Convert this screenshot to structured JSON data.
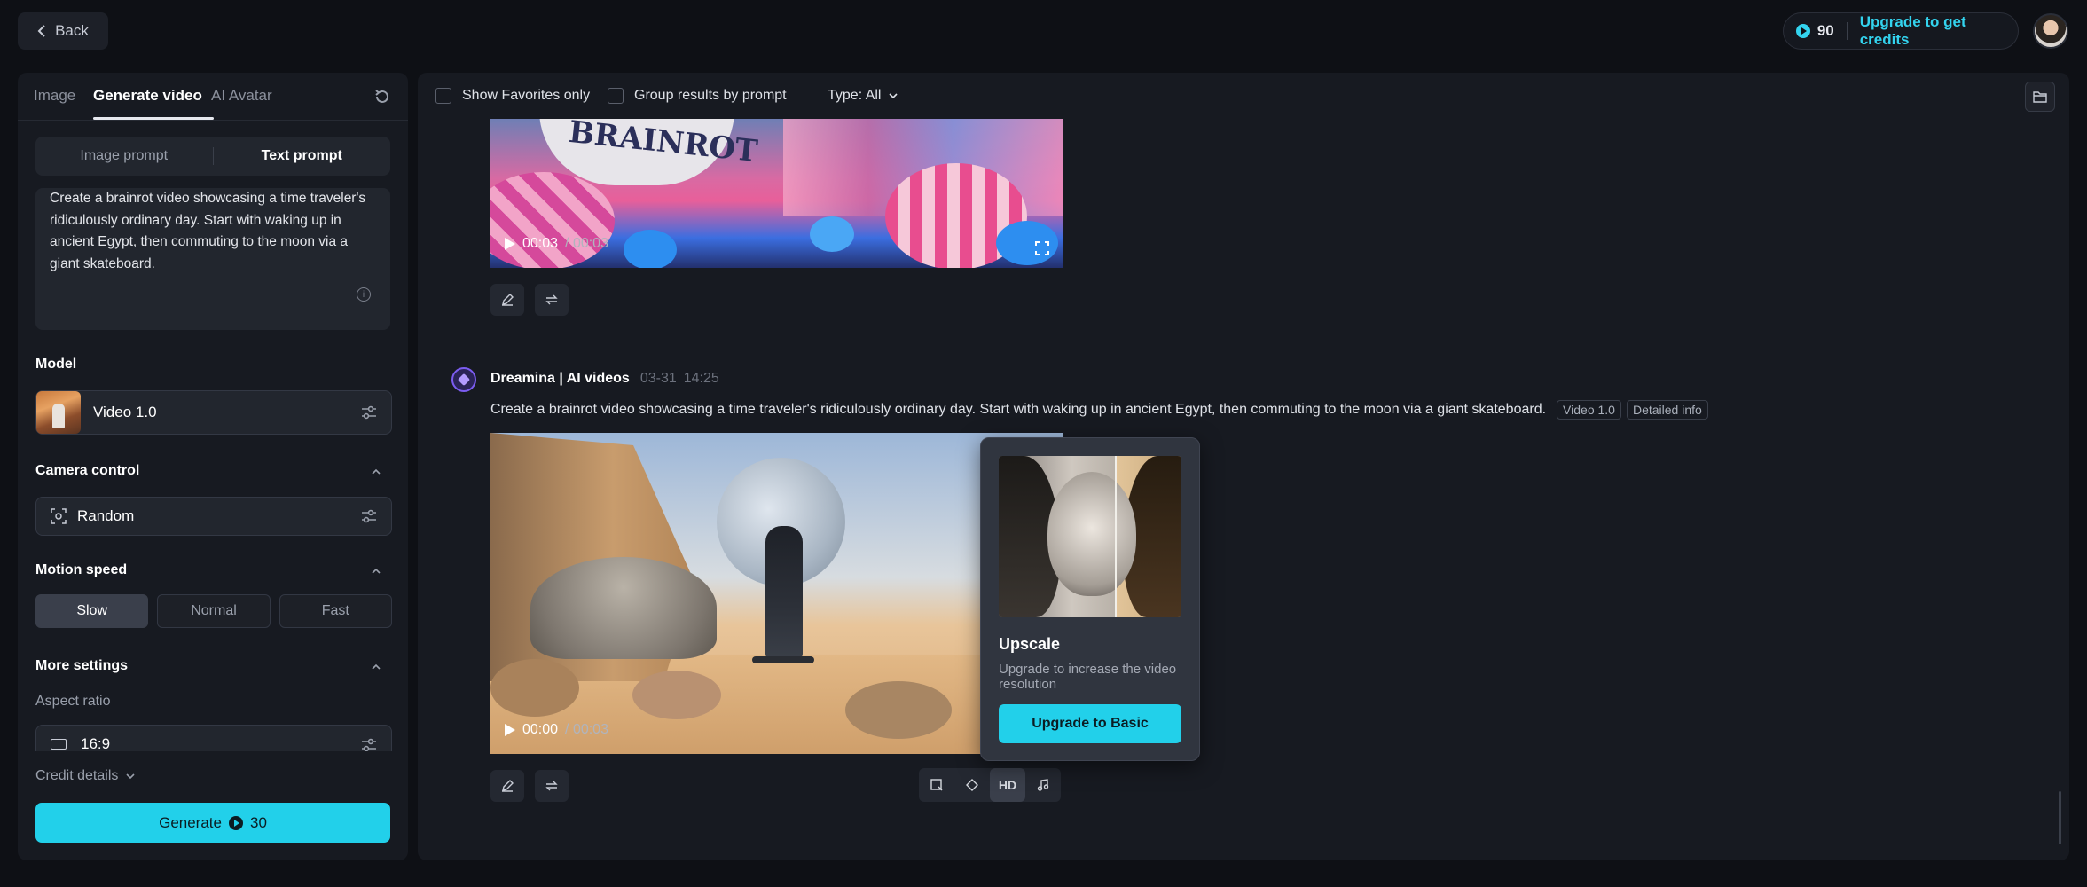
{
  "header": {
    "back_label": "Back",
    "credits": "90",
    "upgrade_label": "Upgrade to get credits"
  },
  "left_panel": {
    "tabs": [
      {
        "label": "Image"
      },
      {
        "label": "Generate video"
      },
      {
        "label": "AI Avatar"
      }
    ],
    "prompt_modes": [
      {
        "label": "Image prompt"
      },
      {
        "label": "Text prompt"
      }
    ],
    "prompt_text": "Create a brainrot video showcasing a time traveler's ridiculously ordinary day. Start with waking up in ancient Egypt, then commuting to the moon via a giant skateboard.",
    "model": {
      "label": "Model",
      "value": "Video 1.0"
    },
    "camera_control": {
      "label": "Camera control",
      "value": "Random"
    },
    "motion_speed": {
      "label": "Motion speed",
      "options": [
        "Slow",
        "Normal",
        "Fast"
      ],
      "selected": "Slow"
    },
    "more_settings": {
      "label": "More settings",
      "aspect_ratio_label": "Aspect ratio",
      "aspect_ratio_value": "16:9"
    },
    "credit_details_label": "Credit details",
    "generate": {
      "label": "Generate",
      "cost": "30"
    }
  },
  "main": {
    "filters": {
      "favorites_label": "Show Favorites only",
      "group_label": "Group results by prompt",
      "type_label": "Type: All"
    },
    "video1": {
      "current": "00:03",
      "duration": "/ 00:03",
      "text_overlay": "BRAINROT"
    },
    "message": {
      "author": "Dreamina | AI videos",
      "date": "03-31",
      "time": "14:25",
      "text": "Create a brainrot video showcasing a time traveler's ridiculously ordinary day. Start with waking up in ancient Egypt, then commuting to the moon via a giant skateboard.",
      "tag_model": "Video 1.0",
      "tag_info": "Detailed info"
    },
    "video2": {
      "current": "00:00",
      "duration": "/ 00:03"
    },
    "upscale_popover": {
      "title": "Upscale",
      "description": "Upgrade to increase the video resolution",
      "button_label": "Upgrade to Basic"
    },
    "video_actions": {
      "hd_label": "HD"
    }
  },
  "colors": {
    "accent": "#22d0ea",
    "background": "#0e1015",
    "panel": "#171a21"
  }
}
